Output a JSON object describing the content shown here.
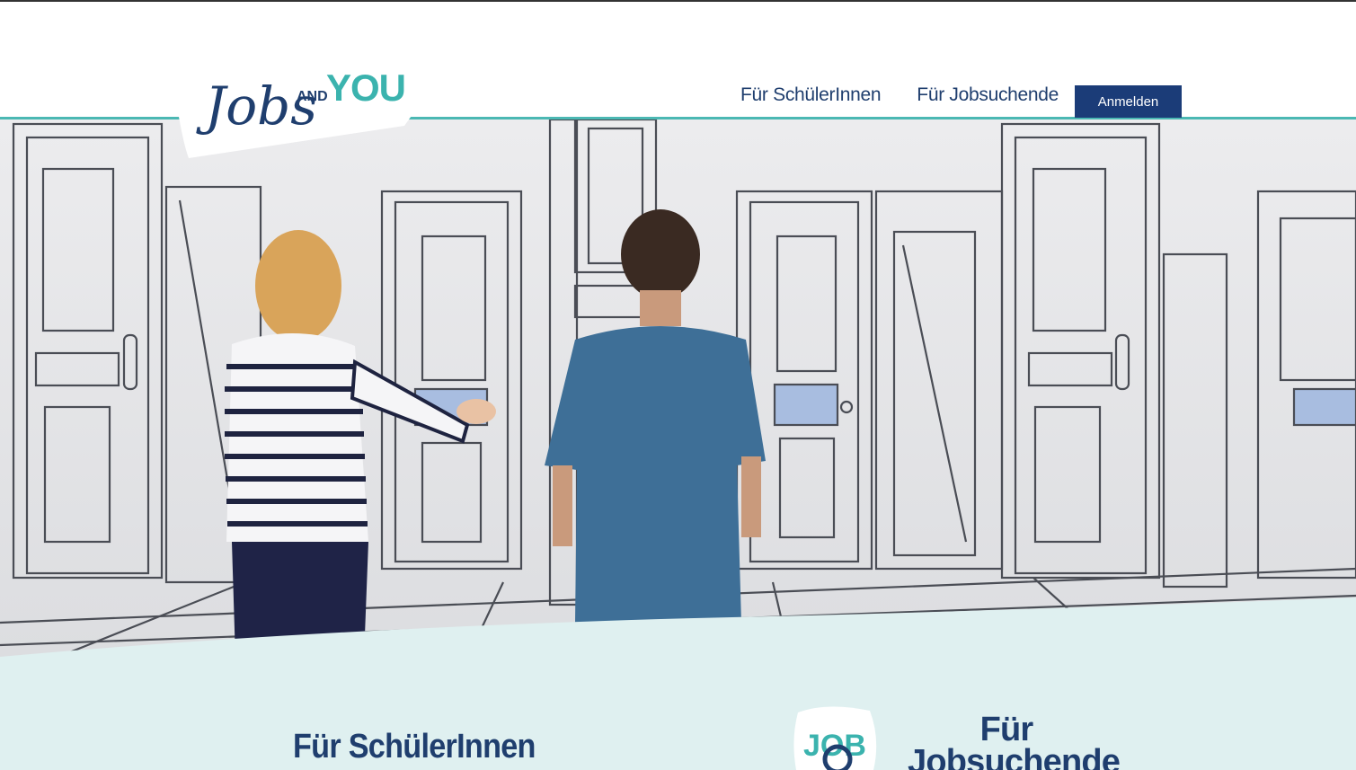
{
  "header": {
    "logo": {
      "script": "Jobs",
      "and": "AND",
      "you": "YOU"
    },
    "nav": {
      "link1": "Für SchülerInnen",
      "link2": "Für Jobsuchende",
      "login_button": "Anmelden"
    }
  },
  "hero": {
    "description_icon": "hero-photo-doors"
  },
  "sections": {
    "students_title": "Für SchülerInnen",
    "jobseekers_title": "Für Jobsuchende",
    "job_icon_text": "JOB"
  },
  "colors": {
    "navy": "#1f3e6e",
    "teal": "#4bb8b3",
    "button": "#1b3c78",
    "section_bg": "#dff0f0"
  }
}
